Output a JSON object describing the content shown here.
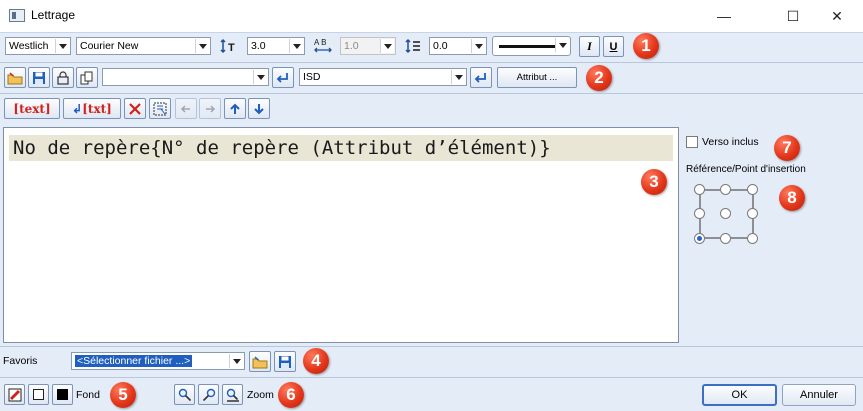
{
  "window": {
    "title": "Lettrage",
    "minimize": "—",
    "maximize": "☐",
    "close": "✕"
  },
  "toolbar1": {
    "style_select": "Westlich",
    "font_select": "Courier New",
    "height_value": "3.0",
    "spacing_value": "1.0",
    "line_spacing_value": "0.0",
    "italic_label": "I",
    "underline_label": "U"
  },
  "toolbar2": {
    "text_select": "",
    "isd_select": "ISD",
    "attribute_button": "Attribut ..."
  },
  "toolbar3": {
    "text_button": "text",
    "text_insert_button": "txt"
  },
  "editor": {
    "content": "No de repère{N° de repère (Attribut d’élément)}"
  },
  "side": {
    "verso_label": "Verso inclus",
    "reference_label": "Référence/Point d'insertion",
    "selected_point": 6
  },
  "favorites": {
    "label": "Favoris",
    "select_value": "<Sélectionner fichier ...>"
  },
  "bottom": {
    "fond_label": "Fond",
    "zoom_label": "Zoom",
    "ok_label": "OK",
    "cancel_label": "Annuler"
  },
  "callouts": [
    "1",
    "2",
    "3",
    "4",
    "5",
    "6",
    "7",
    "8"
  ],
  "colors": {
    "accent": "#2a62c9",
    "callout": "#e3361b",
    "editor_highlight": "#e9e6d6",
    "panel": "#e4ecf7"
  }
}
